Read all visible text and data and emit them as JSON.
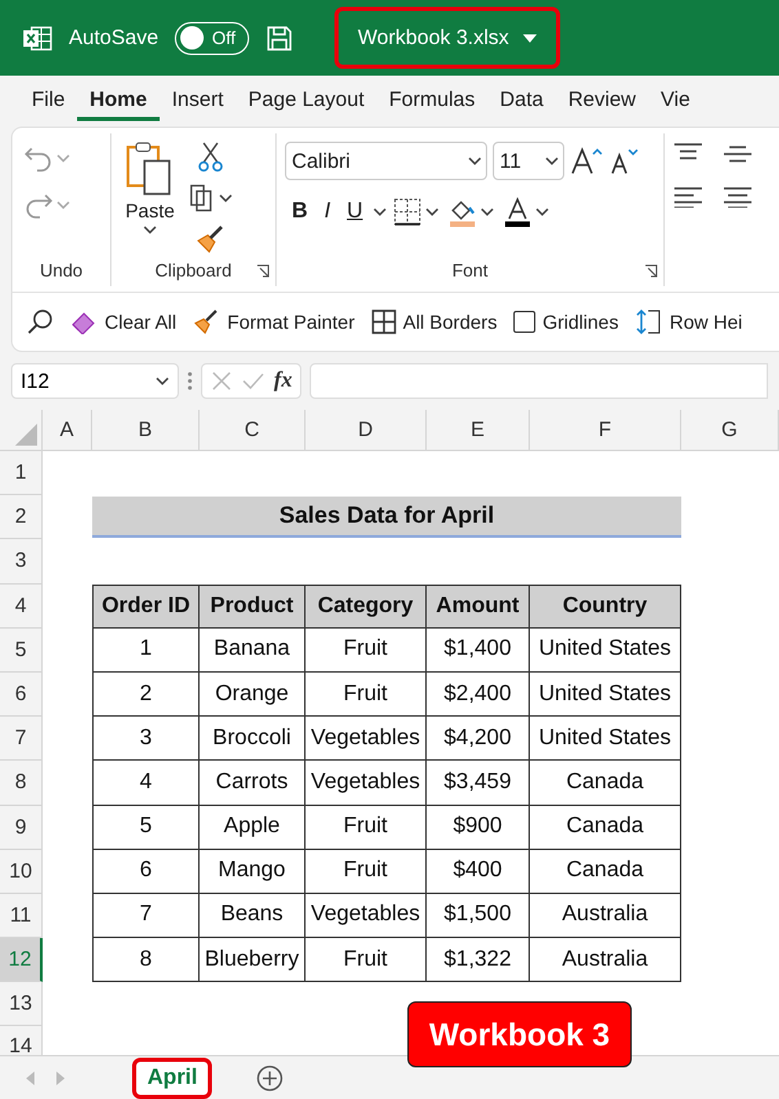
{
  "title_bar": {
    "autosave_label": "AutoSave",
    "autosave_toggle": {
      "on": false,
      "label": "Off"
    },
    "file_name": "Workbook 3.xlsx",
    "file_name_outlined": true
  },
  "ribbon_tabs": [
    {
      "label": "File",
      "selected": false
    },
    {
      "label": "Home",
      "selected": true
    },
    {
      "label": "Insert",
      "selected": false
    },
    {
      "label": "Page Layout",
      "selected": false
    },
    {
      "label": "Formulas",
      "selected": false
    },
    {
      "label": "Data",
      "selected": false
    },
    {
      "label": "Review",
      "selected": false
    },
    {
      "label": "Vie",
      "selected": false
    }
  ],
  "ribbon": {
    "undo_group": "Undo",
    "clipboard_group": "Clipboard",
    "paste_label": "Paste",
    "font_group": "Font",
    "font_name": "Calibri",
    "font_size": "11",
    "bold": "B",
    "italic": "I",
    "underline": "U"
  },
  "quick_actions": [
    {
      "kind": "eraser",
      "label": "Clear All"
    },
    {
      "kind": "painter",
      "label": "Format Painter"
    },
    {
      "kind": "borders",
      "label": "All Borders"
    },
    {
      "kind": "checkbox",
      "label": "Gridlines",
      "checked": false
    },
    {
      "kind": "height",
      "label": "Row Hei"
    }
  ],
  "formula_bar": {
    "name_box": "I12",
    "fx": "fx"
  },
  "columns": [
    {
      "label": "A",
      "selected": false
    },
    {
      "label": "B",
      "selected": false
    },
    {
      "label": "C",
      "selected": false
    },
    {
      "label": "D",
      "selected": false
    },
    {
      "label": "E",
      "selected": false
    },
    {
      "label": "F",
      "selected": false
    },
    {
      "label": "G",
      "selected": false
    }
  ],
  "rows": [
    {
      "label": "1",
      "selected": false
    },
    {
      "label": "2",
      "selected": false
    },
    {
      "label": "3",
      "selected": false
    },
    {
      "label": "4",
      "selected": false
    },
    {
      "label": "5",
      "selected": false
    },
    {
      "label": "6",
      "selected": false
    },
    {
      "label": "7",
      "selected": false
    },
    {
      "label": "8",
      "selected": false
    },
    {
      "label": "9",
      "selected": false
    },
    {
      "label": "10",
      "selected": false
    },
    {
      "label": "11",
      "selected": false
    },
    {
      "label": "12",
      "selected": true
    },
    {
      "label": "13",
      "selected": false
    },
    {
      "label": "14",
      "selected": false
    }
  ],
  "sheet_title": "Sales Data for April",
  "table": {
    "columns": [
      "Order ID",
      "Product",
      "Category",
      "Amount",
      "Country"
    ],
    "rows": [
      [
        "1",
        "Banana",
        "Fruit",
        "$1,400",
        "United States"
      ],
      [
        "2",
        "Orange",
        "Fruit",
        "$2,400",
        "United States"
      ],
      [
        "3",
        "Broccoli",
        "Vegetables",
        "$4,200",
        "United States"
      ],
      [
        "4",
        "Carrots",
        "Vegetables",
        "$3,459",
        "Canada"
      ],
      [
        "5",
        "Apple",
        "Fruit",
        "$900",
        "Canada"
      ],
      [
        "6",
        "Mango",
        "Fruit",
        "$400",
        "Canada"
      ],
      [
        "7",
        "Beans",
        "Vegetables",
        "$1,500",
        "Australia"
      ],
      [
        "8",
        "Blueberry",
        "Fruit",
        "$1,322",
        "Australia"
      ]
    ]
  },
  "sheet_tabs": [
    {
      "label": "April",
      "selected": true,
      "outlined": true
    }
  ],
  "callout": "Workbook 3"
}
